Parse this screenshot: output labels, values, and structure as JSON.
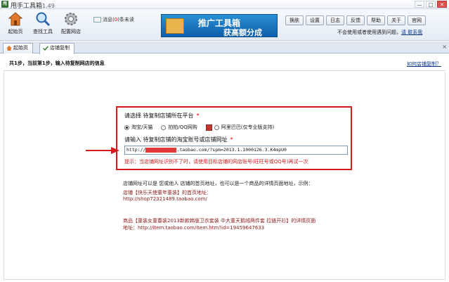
{
  "window": {
    "icon_text": "甩",
    "title": "甩手工具箱",
    "version": "1.49",
    "min": "—",
    "max": "□",
    "close": "✕"
  },
  "toolbar": {
    "items": [
      {
        "label": "起始页",
        "icon": "home-icon"
      },
      {
        "label": "查找工具",
        "icon": "search-icon"
      },
      {
        "label": "配置网店",
        "icon": "gear-icon"
      }
    ],
    "message_prefix": "消息(",
    "message_count": "0",
    "message_suffix": ")条未读",
    "ad_line1": "推广工具箱",
    "ad_line2": "获高额分成",
    "buttons": [
      "换肤",
      "设置",
      "日志",
      "反馈",
      "帮助",
      "关于",
      "官网"
    ],
    "subnote": "不会使用或者使用遇到问题，",
    "subnote_link": "请 联系我"
  },
  "tabs": [
    {
      "label": "起始页",
      "icon": "home-icon"
    },
    {
      "label": "店铺复制",
      "icon": "check-icon"
    }
  ],
  "tab_close": "×",
  "step": {
    "text": "共1步，当前第1步，输入待复制网店的信息",
    "help": "如何店铺复制？"
  },
  "form": {
    "platform_label": "请选择 待复制店铺所在平台",
    "required_mark": "*",
    "platforms": [
      {
        "label": "淘宝/天猫",
        "selected": true
      },
      {
        "label": "拍拍/QQ网购",
        "selected": false
      },
      {
        "label": "阿里巴巴(仅专业版支持)",
        "selected": false
      }
    ],
    "url_label": "请输入 待复制店铺的淘宝账号或店铺网址",
    "url_prefix": "http://",
    "url_suffix": ".taobao.com/?spm=2013.1.1000126.3.K4mpU0",
    "tip": "提示：当店铺网址识别不了时，请使用目标店铺的网店账号(旺旺号或QQ号)再试一次"
  },
  "info": {
    "line1": "店铺网址可以是 您或他人 店铺的首页地址，也可以是一个商品的详情页面地址，示例：",
    "line2": "店铺【快乐天使童年童装】的首页地址：",
    "line3": "http://shop72321489.taobao.com/",
    "line4": "商品【童装女童春装2013新款韩版卫衣套装 中大童天鹅绒两件套 拉链开衫】的详情页面",
    "line5": "地址：http://item.taobao.com/item.htm?id=19459647633"
  },
  "colors": {
    "accent_red": "#d41c1c",
    "link_blue": "#103a8a",
    "ad_blue": "#1a78c2"
  }
}
